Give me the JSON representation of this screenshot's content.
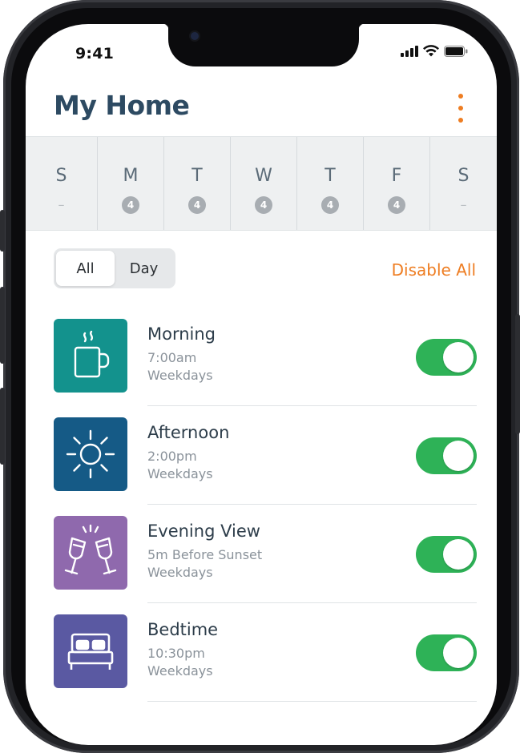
{
  "status_bar": {
    "time": "9:41",
    "icons": [
      "cellular-signal-icon",
      "wifi-icon",
      "battery-icon"
    ]
  },
  "header": {
    "title": "My Home",
    "menu_icon": "kebab-menu-icon",
    "menu_color": "#ee7d22"
  },
  "week": {
    "days": [
      {
        "letter": "S",
        "count": "–"
      },
      {
        "letter": "M",
        "count": "4"
      },
      {
        "letter": "T",
        "count": "4"
      },
      {
        "letter": "W",
        "count": "4"
      },
      {
        "letter": "T",
        "count": "4"
      },
      {
        "letter": "F",
        "count": "4"
      },
      {
        "letter": "S",
        "count": "–"
      }
    ]
  },
  "filter": {
    "options": [
      "All",
      "Day"
    ],
    "selected": "All"
  },
  "actions": {
    "disable_all": "Disable All"
  },
  "schedules": [
    {
      "title": "Morning",
      "time": "7:00am",
      "days": "Weekdays",
      "icon": "coffee-mug-icon",
      "color": "#13928d",
      "enabled": true
    },
    {
      "title": "Afternoon",
      "time": "2:00pm",
      "days": "Weekdays",
      "icon": "sun-icon",
      "color": "#155a86",
      "enabled": true
    },
    {
      "title": "Evening View",
      "time": "5m Before Sunset",
      "days": "Weekdays",
      "icon": "toasting-glasses-icon",
      "color": "#8f69ad",
      "enabled": true
    },
    {
      "title": "Bedtime",
      "time": "10:30pm",
      "days": "Weekdays",
      "icon": "bed-icon",
      "color": "#5a59a2",
      "enabled": true
    }
  ],
  "colors": {
    "accent": "#ee7d22",
    "toggle_on": "#2eb257",
    "title": "#2d4a62"
  }
}
